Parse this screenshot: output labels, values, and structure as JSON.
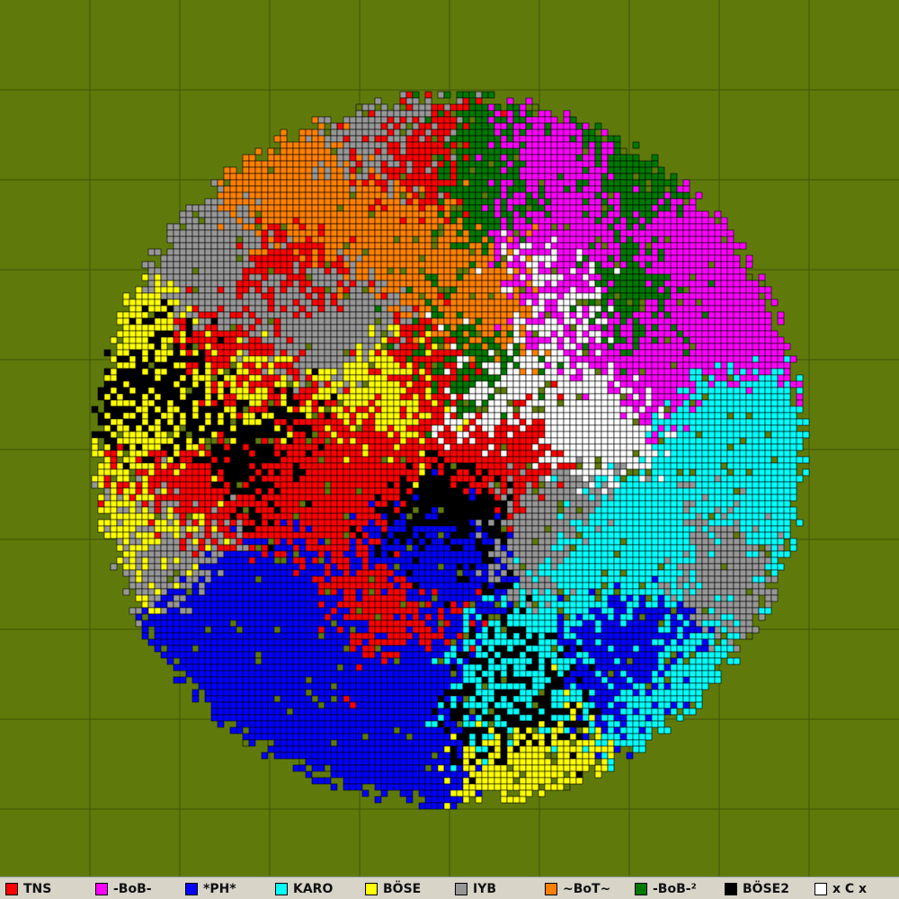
{
  "background_color": "#5f7a0a",
  "grid_color": "#3f5408",
  "teams": [
    {
      "name": "TNS",
      "color": "#ff0000"
    },
    {
      "name": "-BoB-",
      "color": "#ff00ff"
    },
    {
      "name": "*PH*",
      "color": "#0000ff"
    },
    {
      "name": "KARO",
      "color": "#00ffff"
    },
    {
      "name": "BÖSE",
      "color": "#ffff00"
    },
    {
      "name": "IYB",
      "color": "#969696"
    },
    {
      "name": "~BoT~",
      "color": "#ff8000"
    },
    {
      "name": "-BoB-²",
      "color": "#007800"
    },
    {
      "name": "BÖSE2",
      "color": "#000000"
    },
    {
      "name": "x C x",
      "color": "#ffffff"
    }
  ]
}
